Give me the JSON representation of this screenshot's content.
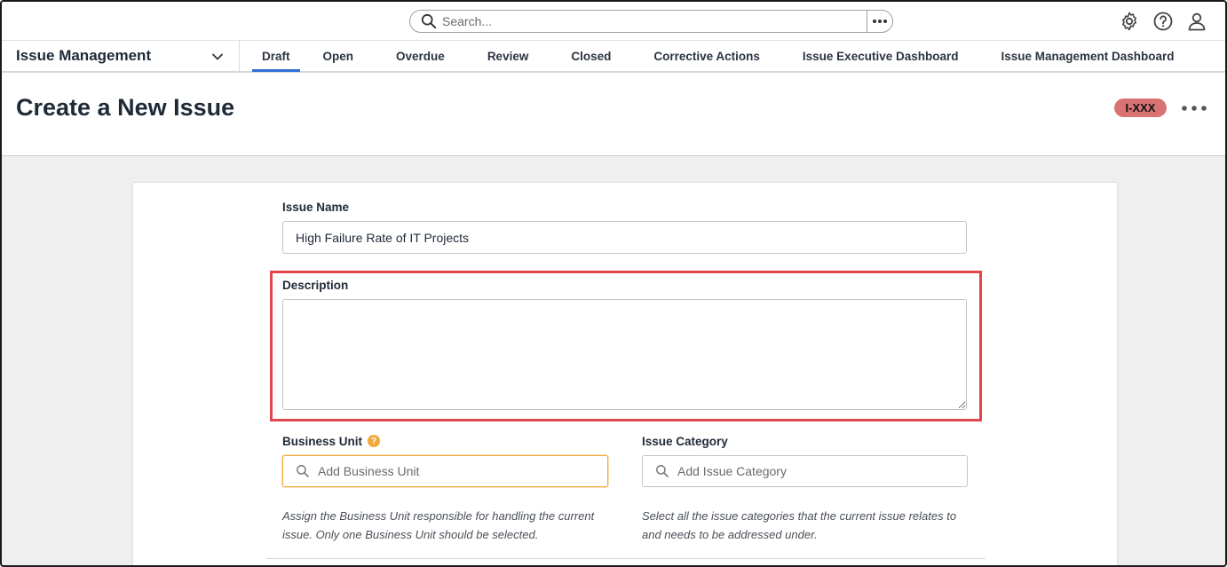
{
  "search": {
    "placeholder": "Search..."
  },
  "top_icons": [
    "gear-icon",
    "help-icon",
    "user-icon"
  ],
  "nav": {
    "app_title": "Issue Management",
    "tabs": [
      {
        "label": "Draft",
        "active": true
      },
      {
        "label": "Open",
        "active": false
      },
      {
        "label": "Overdue",
        "active": false
      },
      {
        "label": "Review",
        "active": false
      },
      {
        "label": "Closed",
        "active": false
      },
      {
        "label": "Corrective Actions",
        "active": false
      },
      {
        "label": "Issue Executive Dashboard",
        "active": false
      },
      {
        "label": "Issue Management Dashboard",
        "active": false
      }
    ]
  },
  "header": {
    "title": "Create a New Issue",
    "badge": "I-XXX"
  },
  "form": {
    "issue_name_label": "Issue Name",
    "issue_name_value": "High Failure Rate of IT Projects",
    "description_label": "Description",
    "description_value": "",
    "business_unit_label": "Business Unit",
    "business_unit_help": "?",
    "business_unit_placeholder": "Add Business Unit",
    "business_unit_hint": "Assign the Business Unit responsible for handling the current issue. Only one Business Unit should be selected.",
    "issue_category_label": "Issue Category",
    "issue_category_placeholder": "Add Issue Category",
    "issue_category_hint": "Select all the issue categories that the current issue relates to and needs to be addressed under."
  },
  "colors": {
    "accent": "#2f6fd6",
    "badge": "#d97373",
    "highlight": "#e0474c",
    "focus": "#f0a93b"
  }
}
